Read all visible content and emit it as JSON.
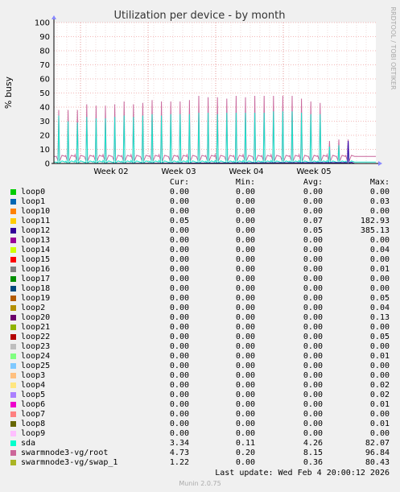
{
  "chart_data": {
    "type": "line",
    "title": "Utilization per device - by month",
    "ylabel": "% busy",
    "side_label": "RRDTOOL / TOBI OETIKER",
    "ylim": [
      0,
      100
    ],
    "yticks": [
      0,
      10,
      20,
      30,
      40,
      50,
      60,
      70,
      80,
      90,
      100
    ],
    "xticks": [
      "Week 02",
      "Week 03",
      "Week 04",
      "Week 05"
    ],
    "series": [
      {
        "name": "swarmnode3-vg/root",
        "color": "#c8679c",
        "baseline": 5,
        "peaks": [
          38,
          38,
          38,
          42,
          41,
          41,
          42,
          44,
          42,
          43,
          45,
          44,
          44,
          44,
          45,
          48,
          47,
          47,
          46,
          48,
          47,
          48,
          48,
          48,
          48,
          48,
          46,
          44,
          43,
          16,
          17,
          17
        ]
      },
      {
        "name": "sda",
        "color": "#1cdfc8",
        "baseline": 1,
        "peaks": [
          34,
          30,
          29,
          33,
          32,
          32,
          33,
          34,
          33,
          34,
          35,
          34,
          35,
          35,
          35,
          36,
          36,
          35,
          36,
          36,
          36,
          36,
          36,
          37,
          37,
          37,
          36,
          35,
          35,
          12,
          13,
          13
        ]
      },
      {
        "name": "loop12",
        "color": "#3300aa",
        "baseline": 0,
        "peaks": [
          0,
          0,
          0,
          0,
          0,
          0,
          0,
          0,
          0,
          0,
          0,
          0,
          0,
          0,
          0,
          0,
          0,
          0,
          0,
          0,
          0,
          0,
          0,
          0,
          0,
          0,
          0,
          0,
          0,
          0,
          0,
          16
        ]
      }
    ]
  },
  "legend": {
    "headers": {
      "cur": "Cur:",
      "min": "Min:",
      "avg": "Avg:",
      "max": "Max:"
    },
    "rows": [
      {
        "name": "loop0",
        "color": "#00cc00",
        "cur": "0.00",
        "min": "0.00",
        "avg": "0.00",
        "max": "0.00"
      },
      {
        "name": "loop1",
        "color": "#0066b3",
        "cur": "0.00",
        "min": "0.00",
        "avg": "0.00",
        "max": "0.03"
      },
      {
        "name": "loop10",
        "color": "#ff8000",
        "cur": "0.00",
        "min": "0.00",
        "avg": "0.00",
        "max": "0.00"
      },
      {
        "name": "loop11",
        "color": "#ffcc00",
        "cur": "0.05",
        "min": "0.00",
        "avg": "0.07",
        "max": "182.93"
      },
      {
        "name": "loop12",
        "color": "#330099",
        "cur": "0.00",
        "min": "0.00",
        "avg": "0.05",
        "max": "385.13"
      },
      {
        "name": "loop13",
        "color": "#990099",
        "cur": "0.00",
        "min": "0.00",
        "avg": "0.00",
        "max": "0.00"
      },
      {
        "name": "loop14",
        "color": "#ccff00",
        "cur": "0.00",
        "min": "0.00",
        "avg": "0.00",
        "max": "0.04"
      },
      {
        "name": "loop15",
        "color": "#ff0000",
        "cur": "0.00",
        "min": "0.00",
        "avg": "0.00",
        "max": "0.00"
      },
      {
        "name": "loop16",
        "color": "#808080",
        "cur": "0.00",
        "min": "0.00",
        "avg": "0.00",
        "max": "0.01"
      },
      {
        "name": "loop17",
        "color": "#008f00",
        "cur": "0.00",
        "min": "0.00",
        "avg": "0.00",
        "max": "0.00"
      },
      {
        "name": "loop18",
        "color": "#00487d",
        "cur": "0.00",
        "min": "0.00",
        "avg": "0.00",
        "max": "0.00"
      },
      {
        "name": "loop19",
        "color": "#b35a00",
        "cur": "0.00",
        "min": "0.00",
        "avg": "0.00",
        "max": "0.05"
      },
      {
        "name": "loop2",
        "color": "#b38f00",
        "cur": "0.00",
        "min": "0.00",
        "avg": "0.00",
        "max": "0.04"
      },
      {
        "name": "loop20",
        "color": "#6b006b",
        "cur": "0.00",
        "min": "0.00",
        "avg": "0.00",
        "max": "0.13"
      },
      {
        "name": "loop21",
        "color": "#8fb300",
        "cur": "0.00",
        "min": "0.00",
        "avg": "0.00",
        "max": "0.00"
      },
      {
        "name": "loop22",
        "color": "#b30000",
        "cur": "0.00",
        "min": "0.00",
        "avg": "0.00",
        "max": "0.05"
      },
      {
        "name": "loop23",
        "color": "#bebebe",
        "cur": "0.00",
        "min": "0.00",
        "avg": "0.00",
        "max": "0.00"
      },
      {
        "name": "loop24",
        "color": "#80ff80",
        "cur": "0.00",
        "min": "0.00",
        "avg": "0.00",
        "max": "0.01"
      },
      {
        "name": "loop25",
        "color": "#80c9ff",
        "cur": "0.00",
        "min": "0.00",
        "avg": "0.00",
        "max": "0.00"
      },
      {
        "name": "loop3",
        "color": "#ffc080",
        "cur": "0.00",
        "min": "0.00",
        "avg": "0.00",
        "max": "0.00"
      },
      {
        "name": "loop4",
        "color": "#ffe680",
        "cur": "0.00",
        "min": "0.00",
        "avg": "0.00",
        "max": "0.02"
      },
      {
        "name": "loop5",
        "color": "#aa80ff",
        "cur": "0.00",
        "min": "0.00",
        "avg": "0.00",
        "max": "0.02"
      },
      {
        "name": "loop6",
        "color": "#ee00cc",
        "cur": "0.00",
        "min": "0.00",
        "avg": "0.00",
        "max": "0.01"
      },
      {
        "name": "loop7",
        "color": "#ff8080",
        "cur": "0.00",
        "min": "0.00",
        "avg": "0.00",
        "max": "0.00"
      },
      {
        "name": "loop8",
        "color": "#666600",
        "cur": "0.00",
        "min": "0.00",
        "avg": "0.00",
        "max": "0.01"
      },
      {
        "name": "loop9",
        "color": "#ffbfff",
        "cur": "0.00",
        "min": "0.00",
        "avg": "0.00",
        "max": "0.00"
      },
      {
        "name": "sda",
        "color": "#00ffcc",
        "cur": "3.34",
        "min": "0.11",
        "avg": "4.26",
        "max": "82.07"
      },
      {
        "name": "swarmnode3-vg/root",
        "color": "#cc6699",
        "cur": "4.73",
        "min": "0.20",
        "avg": "8.15",
        "max": "96.84"
      },
      {
        "name": "swarmnode3-vg/swap_1",
        "color": "#aab424",
        "cur": "1.22",
        "min": "0.00",
        "avg": "0.36",
        "max": "80.43"
      }
    ]
  },
  "footer": {
    "last_update": "Last update: Wed Feb  4 20:00:12 2026",
    "munin": "Munin 2.0.75"
  }
}
